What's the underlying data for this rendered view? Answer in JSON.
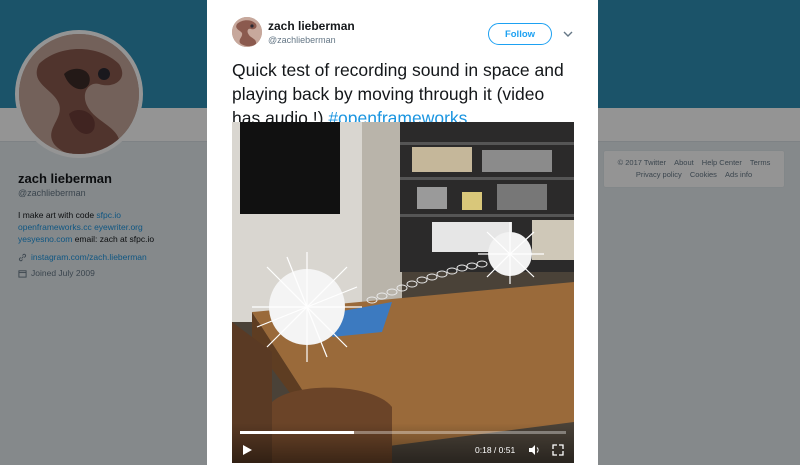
{
  "profile": {
    "name": "zach lieberman",
    "handle": "@zachlieberman",
    "bio": {
      "line1_text": "I make art with code ",
      "line1_link": "sfpc.io",
      "line2_link1": "openframeworks.cc",
      "line2_link2": "eyewriter.org",
      "line3_link": "yesyesno.com",
      "line3_text": " email: zach at sfpc.io"
    },
    "website": "instagram.com/zach.lieberman",
    "joined": "Joined July 2009"
  },
  "footer": {
    "copyright": "© 2017 Twitter",
    "about": "About",
    "help": "Help Center",
    "terms": "Terms",
    "privacy": "Privacy policy",
    "cookies": "Cookies",
    "ads": "Ads info"
  },
  "tweet": {
    "author_name": "zach lieberman",
    "author_handle": "@zachlieberman",
    "follow_label": "Follow",
    "text": "Quick test of recording sound in space and playing back by moving through it (video has audio !) ",
    "hashtag": "#openframeworks"
  },
  "video": {
    "elapsed": "0:18",
    "duration": "0:51",
    "time_display": "0:18 / 0:51",
    "progress": 0.35
  },
  "colors": {
    "banner": "#2f8fb5",
    "link": "#1b95e0",
    "follow": "#1da1f2"
  },
  "icons": {
    "caret": "chevron-down-icon",
    "play": "play-icon",
    "volume": "volume-icon",
    "fullscreen": "fullscreen-icon",
    "link": "link-icon",
    "calendar": "calendar-icon"
  }
}
